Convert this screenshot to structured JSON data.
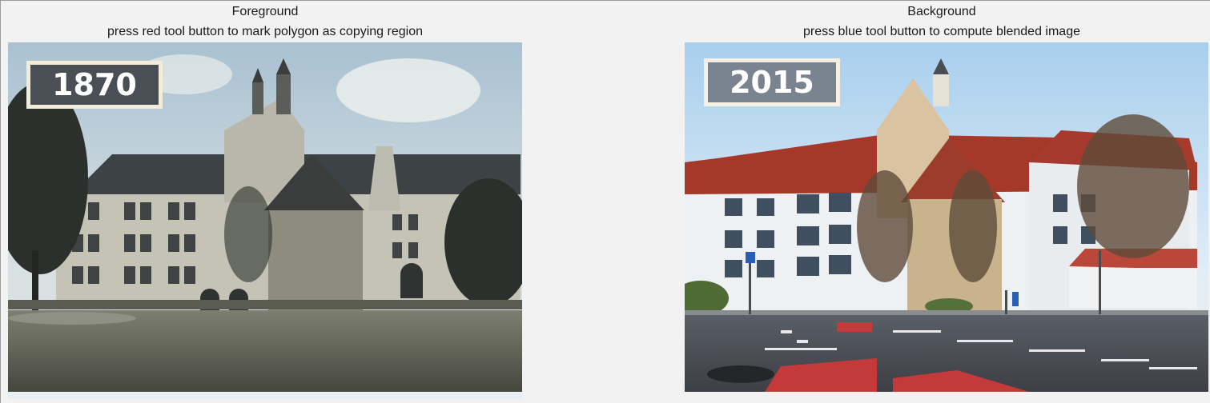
{
  "foreground": {
    "title": "Foreground",
    "instruction": "press red tool button to mark polygon as copying region",
    "year_label": "1870",
    "image_kind": "sepia-photo-historic-building"
  },
  "background": {
    "title": "Background",
    "instruction": "press blue tool button to compute blended image",
    "year_label": "2015",
    "image_kind": "color-photo-modern-building"
  },
  "colors": {
    "tool_red": "#d62b2b",
    "tool_blue": "#2b5fd6",
    "window_bg": "#f2f2f2"
  }
}
